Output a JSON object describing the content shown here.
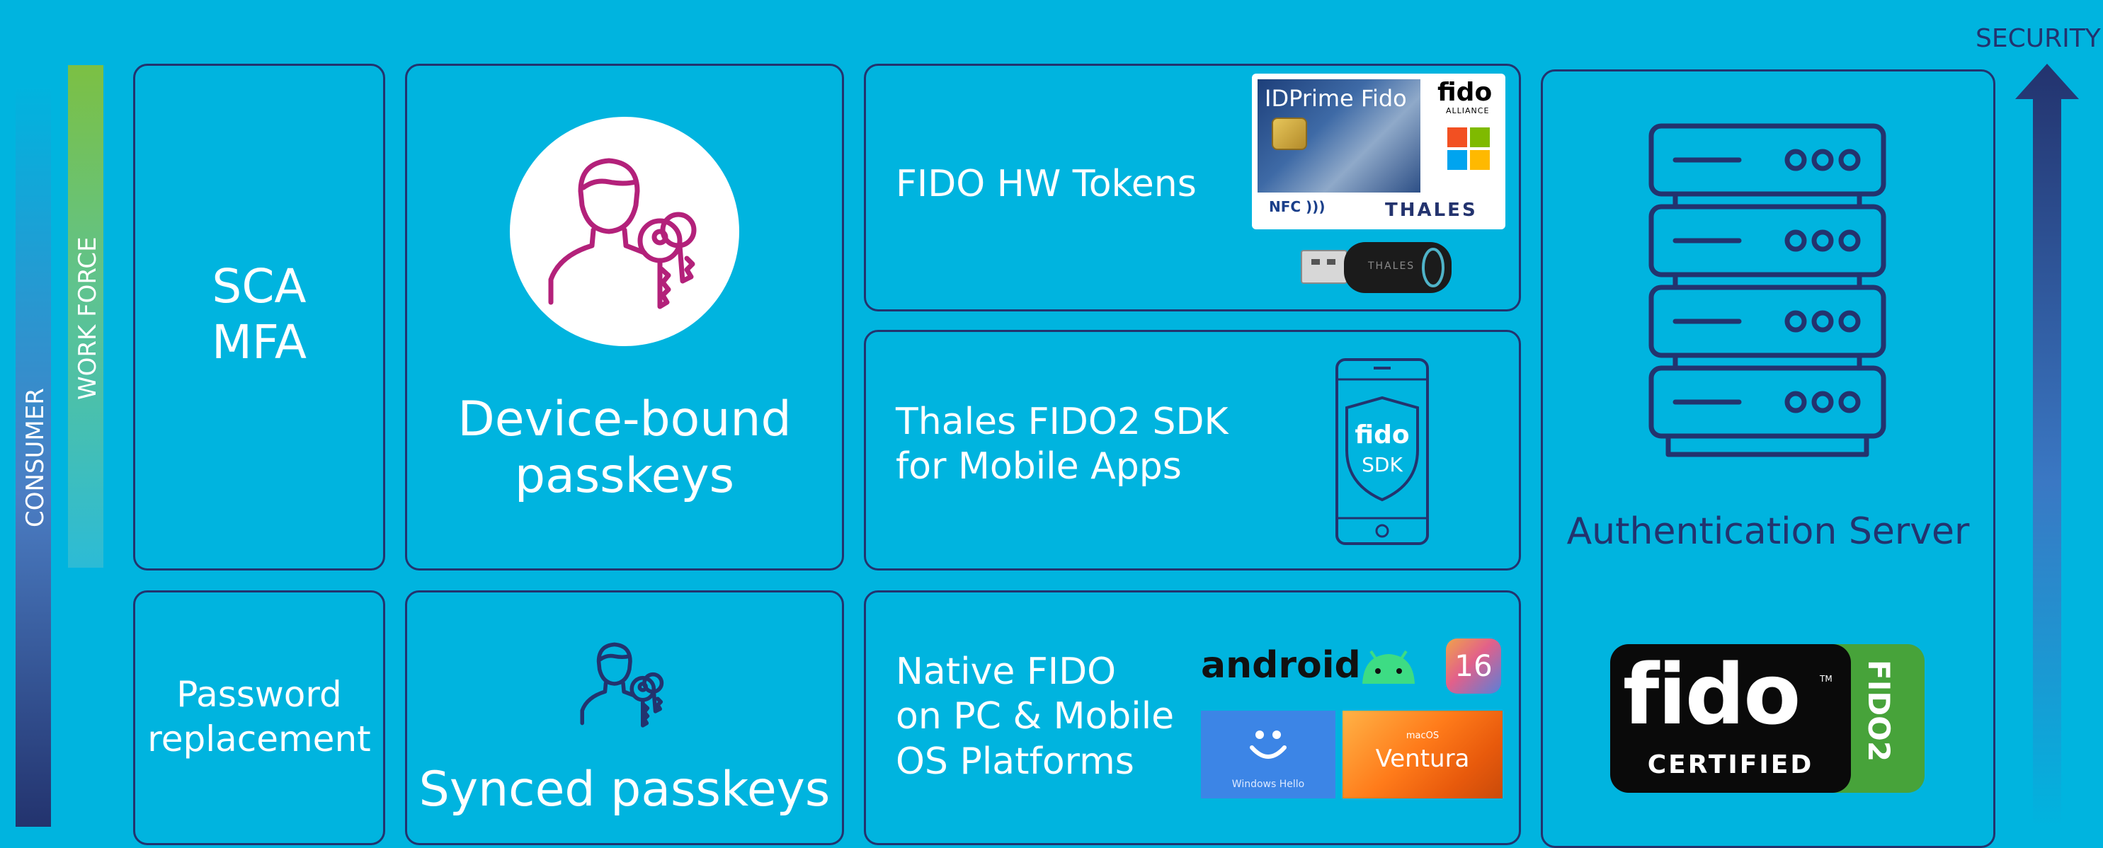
{
  "colors": {
    "background": "#00b4df",
    "border": "#23336e",
    "text_light": "#ffffff",
    "text_dark": "#23336e",
    "thales_magenta": "#b3217a",
    "fido_yellow": "#f4b61a",
    "fido_green": "#47a33a",
    "workforce_bar_top": "#7cc043",
    "android_green": "#3ddc84"
  },
  "axes": {
    "consumer": "CONSUMER",
    "workforce": "WORK FORCE",
    "security": "SECURITY"
  },
  "use_cases": {
    "sca_mfa_line1": "SCA",
    "sca_mfa_line2": "MFA",
    "password_line1": "Password",
    "password_line2": "replacement"
  },
  "passkeys": {
    "device_bound_line1": "Device-bound",
    "device_bound_line2": "passkeys",
    "synced": "Synced passkeys"
  },
  "solutions": {
    "hw_tokens": "FIDO HW Tokens",
    "sdk_line1": "Thales FIDO2 SDK",
    "sdk_line2": "for Mobile Apps",
    "native_line1": "Native FIDO",
    "native_line2": "on PC & Mobile",
    "native_line3": "OS Platforms"
  },
  "card": {
    "title": "IDPrime Fido",
    "fido_logo": "fido",
    "fido_alliance": "ALLIANCE",
    "nfc": "NFC",
    "brand": "THALES"
  },
  "usb_key": {
    "brand": "THALES"
  },
  "sdk_shield": {
    "fido": "fido",
    "sdk": "SDK"
  },
  "os_logos": {
    "android": "android",
    "ios_version": "16",
    "windows_hello": "Windows Hello",
    "macos_small": "macOS",
    "macos_name": "Ventura"
  },
  "server": {
    "label": "Authentication Server"
  },
  "certified": {
    "fido": "fido",
    "tm": "TM",
    "certified": "CERTIFIED",
    "fido2": "FIDO2"
  },
  "icons": [
    "user-key-icon",
    "server-stack-icon",
    "smartphone-icon",
    "smiley-icon",
    "android-robot-icon",
    "usb-key-icon",
    "chip-icon",
    "nfc-icon",
    "windows-logo-icon"
  ]
}
